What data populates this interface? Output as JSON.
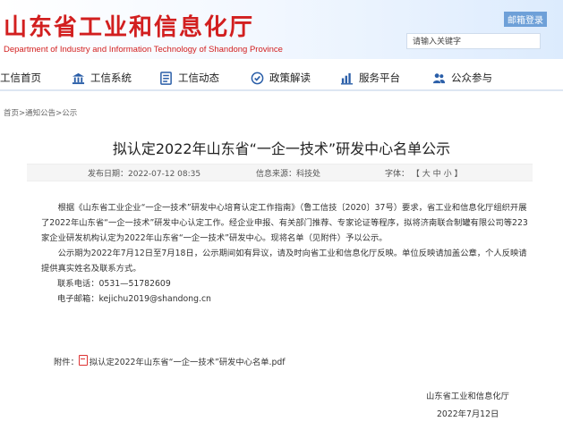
{
  "header": {
    "title": "山东省工业和信息化厅",
    "subtitle": "Department of Industry and Information Technology of Shandong Province",
    "top_link": "邮箱登录",
    "search_placeholder": "请输入关键字"
  },
  "nav": {
    "items": [
      {
        "label": "工信首页",
        "icon": "home-icon"
      },
      {
        "label": "工信系统",
        "icon": "building-icon"
      },
      {
        "label": "工信动态",
        "icon": "news-icon"
      },
      {
        "label": "政策解读",
        "icon": "policy-icon"
      },
      {
        "label": "服务平台",
        "icon": "chart-icon"
      },
      {
        "label": "公众参与",
        "icon": "people-icon"
      }
    ]
  },
  "breadcrumb": "首页>通知公告>公示",
  "article": {
    "title": "拟认定2022年山东省“一企一技术”研发中心名单公示",
    "publish_date": "发布日期：2022-07-12 08:35",
    "source": "信息来源：科技处",
    "font_size_label": "字体：",
    "font_sizes": [
      "大",
      "中",
      "小"
    ],
    "paragraph1": "根据《山东省工业企业“一企一技术”研发中心培育认定工作指南》（鲁工信技〔2020〕37号）要求，省工业和信息化厅组织开展了2022年山东省“一企一技术”研发中心认定工作。经企业申报、有关部门推荐、专家论证等程序，拟将济南联合制罐有限公司等223家企业研发机构认定为2022年山东省“一企一技术”研发中心。现将名单（见附件）予以公示。",
    "paragraph2": "公示期为2022年7月12日至7月18日，公示期间如有异议，请及时向省工业和信息化厅反映。单位反映请加盖公章，个人反映请提供真实姓名及联系方式。",
    "phone": "联系电话：0531—51782609",
    "email": "电子邮箱：kejichu2019@shandong.cn",
    "attachment_label": "附件：",
    "attachment_name": "拟认定2022年山东省“一企一技术”研发中心名单.pdf",
    "sign_org": "山东省工业和信息化厅",
    "sign_date": "2022年7月12日"
  },
  "colors": {
    "brand_red": "#d21f1f",
    "header_blue": "#dcebfd",
    "icon_blue": "#2a5ea8"
  }
}
